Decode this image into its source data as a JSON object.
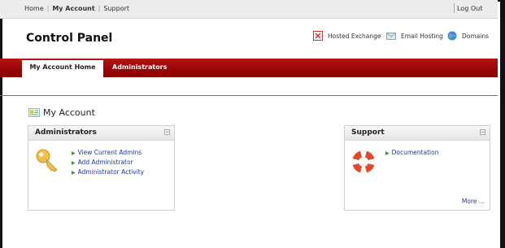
{
  "topnav": {
    "home": "Home",
    "my_account": "My Account",
    "support": "Support",
    "logout": "Log Out",
    "separator": "|"
  },
  "header": {
    "title": "Control Panel",
    "services": [
      {
        "label": "Hosted Exchange",
        "icon": "exchange-icon"
      },
      {
        "label": "Email Hosting",
        "icon": "envelope-icon"
      },
      {
        "label": "Domains",
        "icon": "globe-icon"
      }
    ]
  },
  "tabs": [
    {
      "label": "My Account Home",
      "active": true
    },
    {
      "label": "Administrators",
      "active": false
    }
  ],
  "page": {
    "heading": "My Account",
    "heading_icon": "account-card-icon"
  },
  "panels": {
    "administrators": {
      "title": "Administrators",
      "icon": "key-icon",
      "links": [
        "View Current Admins",
        "Add Administrator",
        "Administrator Activity"
      ]
    },
    "support": {
      "title": "Support",
      "icon": "lifebuoy-icon",
      "links": [
        "Documentation"
      ],
      "more": "More ..."
    }
  },
  "colors": {
    "accent_red": "#a00000",
    "link_blue": "#1a3aa8",
    "bullet_green": "#2a9b2a"
  }
}
